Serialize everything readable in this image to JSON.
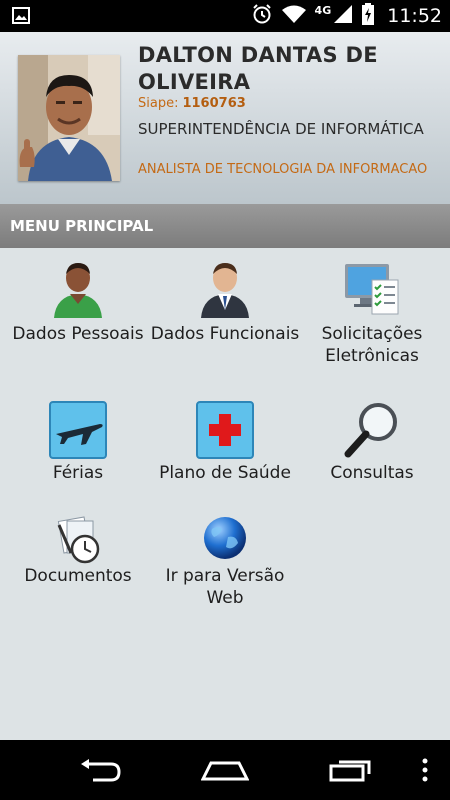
{
  "status_bar": {
    "time": "11:52",
    "network": "4G",
    "icons": [
      "image-icon",
      "alarm-icon",
      "wifi-icon",
      "signal-icon",
      "battery-icon"
    ]
  },
  "profile": {
    "name": "DALTON DANTAS DE OLIVEIRA",
    "siape_label": "Siape:",
    "siape_value": "1160763",
    "department": "SUPERINTENDÊNCIA DE INFORMÁTICA",
    "role": "ANALISTA DE TECNOLOGIA DA INFORMACAO",
    "accent_color": "#c46a15"
  },
  "menu": {
    "title": "MENU PRINCIPAL",
    "items": [
      {
        "label": "Dados Pessoais",
        "icon": "person-green-icon"
      },
      {
        "label": "Dados Funcionais",
        "icon": "businessman-icon"
      },
      {
        "label": "Solicitações Eletrônicas",
        "icon": "computer-checklist-icon"
      },
      {
        "label": "Férias",
        "icon": "airplane-icon"
      },
      {
        "label": "Plano de Saúde",
        "icon": "red-cross-icon"
      },
      {
        "label": "Consultas",
        "icon": "magnifier-icon"
      },
      {
        "label": "Documentos",
        "icon": "documents-clock-icon"
      },
      {
        "label": "Ir para Versão Web",
        "icon": "globe-icon"
      }
    ]
  },
  "navigation_bar": {
    "buttons": [
      "back-icon",
      "home-icon",
      "recents-icon",
      "overflow-menu-icon"
    ]
  }
}
